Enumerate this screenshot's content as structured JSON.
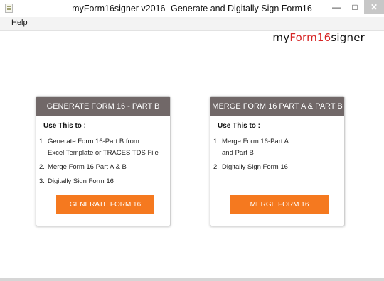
{
  "window": {
    "title": "myForm16signer v2016- Generate and Digitally Sign Form16",
    "minimize_glyph": "—",
    "maximize_glyph": "□",
    "close_glyph": "✕"
  },
  "menu": {
    "items": [
      {
        "label": "Help"
      }
    ]
  },
  "brand": {
    "prefix": "my",
    "highlight": "Form16",
    "suffix": "signer",
    "accent_color": "#d62525"
  },
  "cards": [
    {
      "header": "GENERATE FORM 16 - PART B",
      "subtitle": "Use This to :",
      "steps": [
        {
          "num": "1.",
          "lines": [
            "Generate Form 16-Part B from",
            "Excel Template or TRACES TDS File"
          ]
        },
        {
          "num": "2.",
          "lines": [
            "Merge Form 16 Part A & B"
          ]
        },
        {
          "num": "3.",
          "lines": [
            "Digitally Sign Form 16"
          ]
        }
      ],
      "button": "GENERATE FORM 16"
    },
    {
      "header": "MERGE FORM 16 PART A & PART B",
      "subtitle": "Use This to :",
      "steps": [
        {
          "num": "1.",
          "lines": [
            "Merge Form 16-Part A",
            "and Part B"
          ]
        },
        {
          "num": "2.",
          "lines": [
            "Digitally Sign Form 16"
          ]
        }
      ],
      "button": "MERGE FORM 16"
    }
  ],
  "colors": {
    "header_bg": "#716868",
    "button_bg": "#f5791f"
  }
}
